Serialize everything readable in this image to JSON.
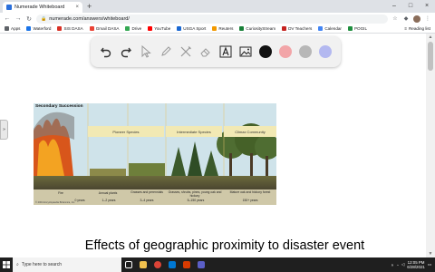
{
  "browser": {
    "tab_title": "Numerade Whiteboard",
    "tab_close": "×",
    "new_tab": "+",
    "url": "numerade.com/answers/whiteboard/",
    "window_controls": [
      "–",
      "□",
      "×"
    ]
  },
  "bookmarks": {
    "items": [
      {
        "label": "Apps",
        "color": "#5f6368"
      },
      {
        "label": "Waterford",
        "color": "#1a73e8"
      },
      {
        "label": "SIS DASA",
        "color": "#d93025"
      },
      {
        "label": "Gmail DASA",
        "color": "#ea4335"
      },
      {
        "label": "Drive",
        "color": "#34a853"
      },
      {
        "label": "YouTube",
        "color": "#ff0000"
      },
      {
        "label": "USGA Sport",
        "color": "#1967d2"
      },
      {
        "label": "Reuters",
        "color": "#f29900"
      },
      {
        "label": "CuriosityStream",
        "color": "#188038"
      },
      {
        "label": "DV Teachers",
        "color": "#c5221f"
      },
      {
        "label": "Calendar",
        "color": "#4285f4"
      },
      {
        "label": "POGIL",
        "color": "#1e8e3e"
      }
    ],
    "reading_list": "Reading list"
  },
  "whiteboard": {
    "tools": [
      "undo-icon",
      "redo-icon",
      "pointer-icon",
      "pen-icon",
      "tools-icon",
      "eraser-icon",
      "text-icon",
      "image-icon"
    ],
    "colors": [
      "#111111",
      "#f2a5a8",
      "#b7b7b7",
      "#b3b8f0"
    ],
    "side_tab": "»"
  },
  "figure": {
    "title": "Secondary Succession",
    "stages": [
      "Pioneer Species",
      "Intermediate Species",
      "Climax Community"
    ],
    "bottom_labels": [
      "Fire",
      "Annual plants",
      "Grasses and perennials",
      "Grasses, shrubs, pines, young oak and hickory",
      "Mature oak and hickory forest"
    ],
    "years": [
      "0 years",
      "1–2 years",
      "3–4 years",
      "5–150 years",
      "150+ years"
    ],
    "credit": "© 2004 Encyclopaedia Britannica, Inc."
  },
  "caption": "Effects of geographic proximity to disaster event",
  "taskbar": {
    "search_placeholder": "Type here to search",
    "time": "12:05 PM",
    "date": "6/28/2021"
  }
}
